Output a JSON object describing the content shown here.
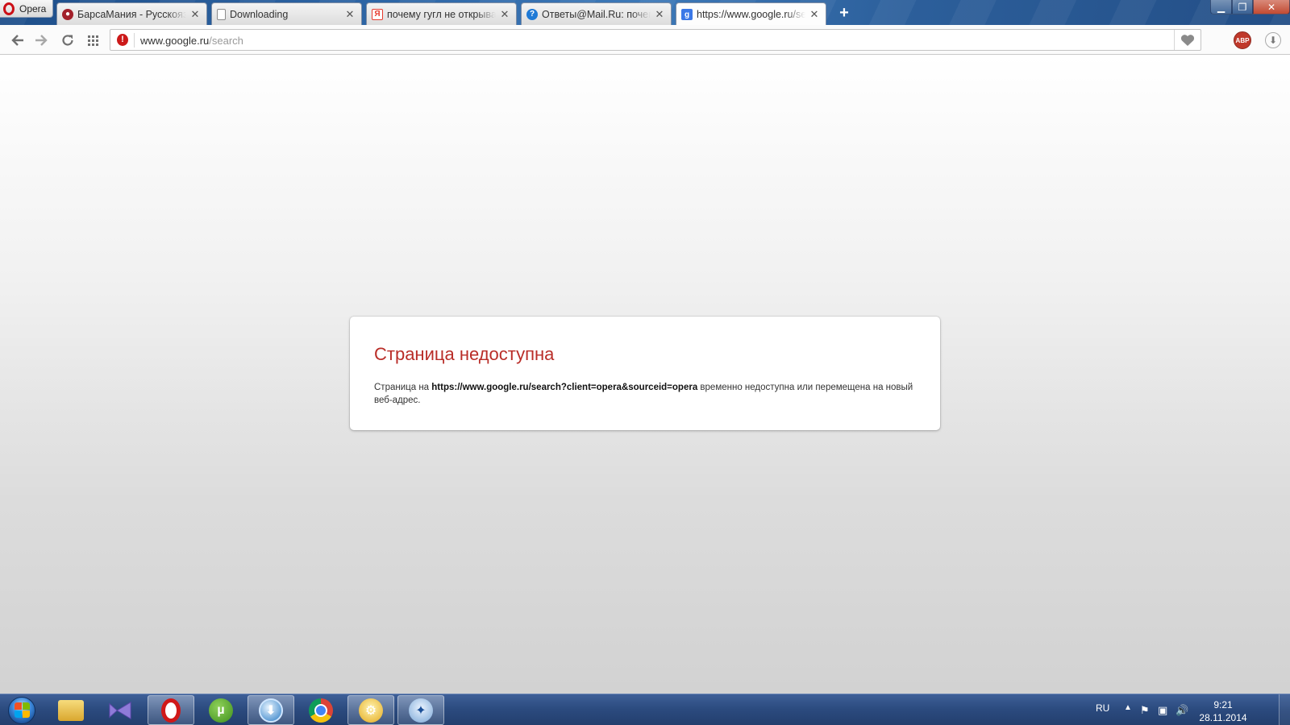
{
  "browser": {
    "menu_label": "Opera",
    "new_tab_symbol": "+",
    "tabs": [
      {
        "title": "БарсаМания - Русскоязычный",
        "favicon": "barsamania-icon",
        "favicon_color": "#a2202a",
        "close": "✕"
      },
      {
        "title": "Downloading",
        "favicon": "document-icon",
        "favicon_color": "#8c8c8c",
        "close": "✕"
      },
      {
        "title": "почему гугл не открывается",
        "favicon": "yandex-icon",
        "favicon_color": "#e63b2e",
        "close": "✕"
      },
      {
        "title": "Ответы@Mail.Ru: почему",
        "favicon": "mailru-answers-icon",
        "favicon_color": "#1f7ad6",
        "close": "✕"
      },
      {
        "title": "https://www.google.ru/search",
        "favicon": "google-icon",
        "favicon_color": "#3b78e7",
        "close": "✕",
        "active": true
      }
    ],
    "window_controls": {
      "minimize": "▁",
      "maximize": "❐",
      "close": "✕"
    }
  },
  "toolbar": {
    "back": "back-arrow-icon",
    "forward": "forward-arrow-icon",
    "reload": "reload-icon",
    "speed_dial": "speed-dial-icon",
    "address": {
      "host": "www.google.ru",
      "path": "/search"
    },
    "adblock_label": "ABP"
  },
  "error_page": {
    "title": "Страница недоступна",
    "text_prefix": "Страница на ",
    "url": "https://www.google.ru/search?client=opera&sourceid=opera",
    "text_suffix": " временно недоступна или перемещена на новый веб-адрес."
  },
  "taskbar": {
    "apps": [
      "windows-explorer-icon",
      "visual-studio-icon",
      "opera-icon",
      "utorrent-icon",
      "qip-icon",
      "chrome-icon",
      "network-icon",
      "puzzle-app-icon"
    ],
    "tray": {
      "language": "RU",
      "time": "9:21",
      "date": "28.11.2014"
    }
  },
  "colors": {
    "error_title": "#b92d28",
    "opera_red": "#cc0f16",
    "taskbar": "#2b4a7e"
  }
}
